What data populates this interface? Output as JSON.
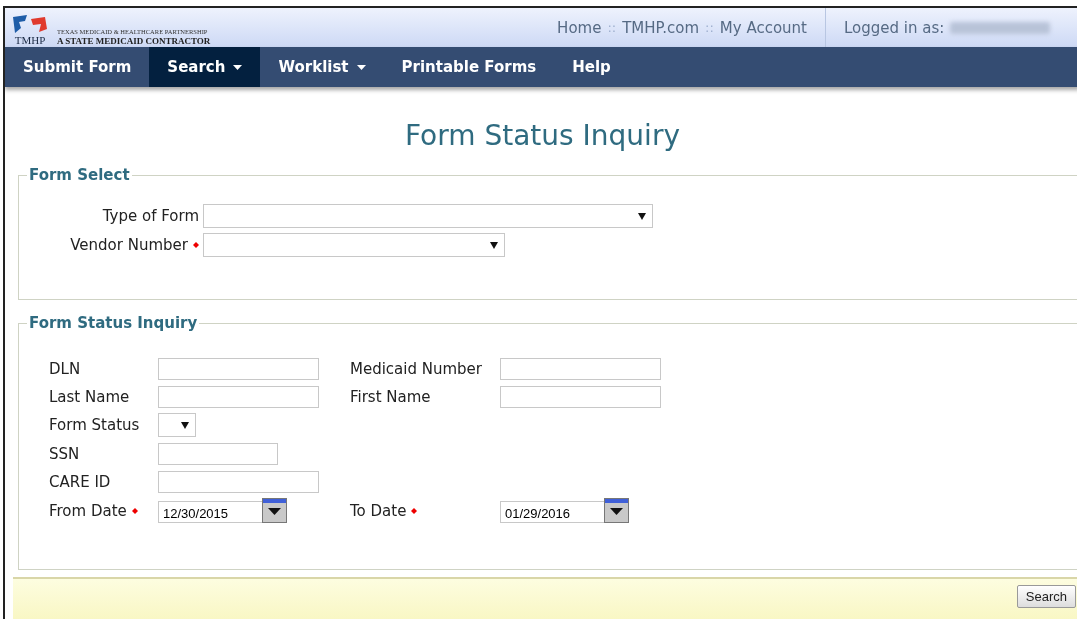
{
  "header": {
    "logo": {
      "abbr": "TMHP",
      "line1": "TEXAS MEDICAID & HEALTHCARE PARTNERSHIP",
      "line2": "A STATE MEDICAID CONTRACTOR"
    },
    "links": [
      "Home",
      "TMHP.com",
      "My Account"
    ],
    "separator": "::",
    "logged_in_label": "Logged in as:"
  },
  "nav": [
    {
      "label": "Submit Form",
      "dropdown": false,
      "selected": false
    },
    {
      "label": "Search",
      "dropdown": true,
      "selected": true
    },
    {
      "label": "Worklist",
      "dropdown": true,
      "selected": false
    },
    {
      "label": "Printable Forms",
      "dropdown": false,
      "selected": false
    },
    {
      "label": "Help",
      "dropdown": false,
      "selected": false
    }
  ],
  "page_title": "Form Status Inquiry",
  "form_select": {
    "legend": "Form Select",
    "fields": [
      {
        "label": "Type of Form",
        "kind": "select",
        "required": false
      },
      {
        "label": "Vendor Number",
        "kind": "select",
        "required": true
      }
    ]
  },
  "inquiry": {
    "legend": "Form Status Inquiry",
    "rows": [
      [
        {
          "label": "DLN",
          "kind": "text",
          "required": false
        },
        {
          "label": "Medicaid Number",
          "kind": "text",
          "required": false
        }
      ],
      [
        {
          "label": "Last Name",
          "kind": "text",
          "required": false
        },
        {
          "label": "First Name",
          "kind": "text",
          "required": false
        }
      ],
      [
        {
          "label": "Form Status",
          "kind": "select",
          "required": false
        }
      ],
      [
        {
          "label": "SSN",
          "kind": "short",
          "required": false
        }
      ],
      [
        {
          "label": "CARE ID",
          "kind": "text",
          "required": false
        }
      ],
      [
        {
          "label": "From Date",
          "kind": "date",
          "required": true,
          "value": "12/30/2015"
        },
        {
          "label": "To Date",
          "kind": "date",
          "required": true,
          "value": "01/29/2016"
        }
      ]
    ]
  },
  "footer": {
    "button": "Search"
  }
}
